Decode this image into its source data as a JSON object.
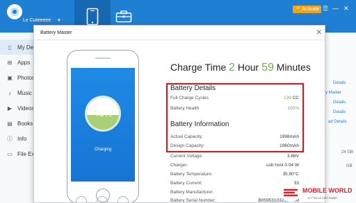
{
  "app": {
    "user_name": "Le Cuteeeee",
    "activate_label": "Activate"
  },
  "sidebar": {
    "items": [
      {
        "label": "My De",
        "icon": "phone-icon"
      },
      {
        "label": "Apps",
        "icon": "apps-icon"
      },
      {
        "label": "Photos",
        "icon": "photos-icon"
      },
      {
        "label": "Music",
        "icon": "music-icon"
      },
      {
        "label": "Videos",
        "icon": "videos-icon"
      },
      {
        "label": "Books",
        "icon": "books-icon"
      },
      {
        "label": "Info",
        "icon": "info-icon"
      },
      {
        "label": "File Ex",
        "icon": "file-explorer-icon"
      }
    ]
  },
  "right_panel": {
    "links": [
      "Details",
      "y Master",
      "Details",
      "Details",
      "ad Details"
    ],
    "size_text": "24 GB",
    "free_text": "GB"
  },
  "dialog": {
    "title": "Battery Master",
    "charge_time": {
      "prefix": "Charge Time",
      "hours": "2",
      "hour_label": "Hour",
      "minutes": "59",
      "minute_label": "Minutes"
    },
    "phone": {
      "percent_text": "46%",
      "status": "Charging"
    },
    "details_title": "Battery Details",
    "details": [
      {
        "label": "Full Charge Cycles",
        "value": "139",
        "unit": "CC"
      },
      {
        "label": "Battery Health",
        "value": "100%",
        "unit": ""
      }
    ],
    "info_title": "Battery Information",
    "info": [
      {
        "label": "Actual Capacity:",
        "value": "1998mAh"
      },
      {
        "label": "Design Capacity:",
        "value": "1960mAh"
      },
      {
        "label": "Current Voltage:",
        "value": "3.88V"
      },
      {
        "label": "Charger:",
        "value": "usb host 0.04 W"
      },
      {
        "label": "Battery Temperature:",
        "value": "35.90°C"
      },
      {
        "label": "Battery Current:",
        "value": "33"
      },
      {
        "label": "Battery Manufacturer:",
        "value": ""
      },
      {
        "label": "Battery Serial Number:",
        "value": "B0595310321680IM"
      }
    ]
  },
  "watermark": {
    "brand": "MOBILE WORLD",
    "tagline": "UY TÍN LÀ SỨC MẠNH"
  },
  "colors": {
    "brand_blue": "#1f7fd2",
    "accent_green": "#6cb33f",
    "highlight_red": "#d0151b",
    "activate_orange": "#f2a319"
  },
  "battery_level": 0.46
}
